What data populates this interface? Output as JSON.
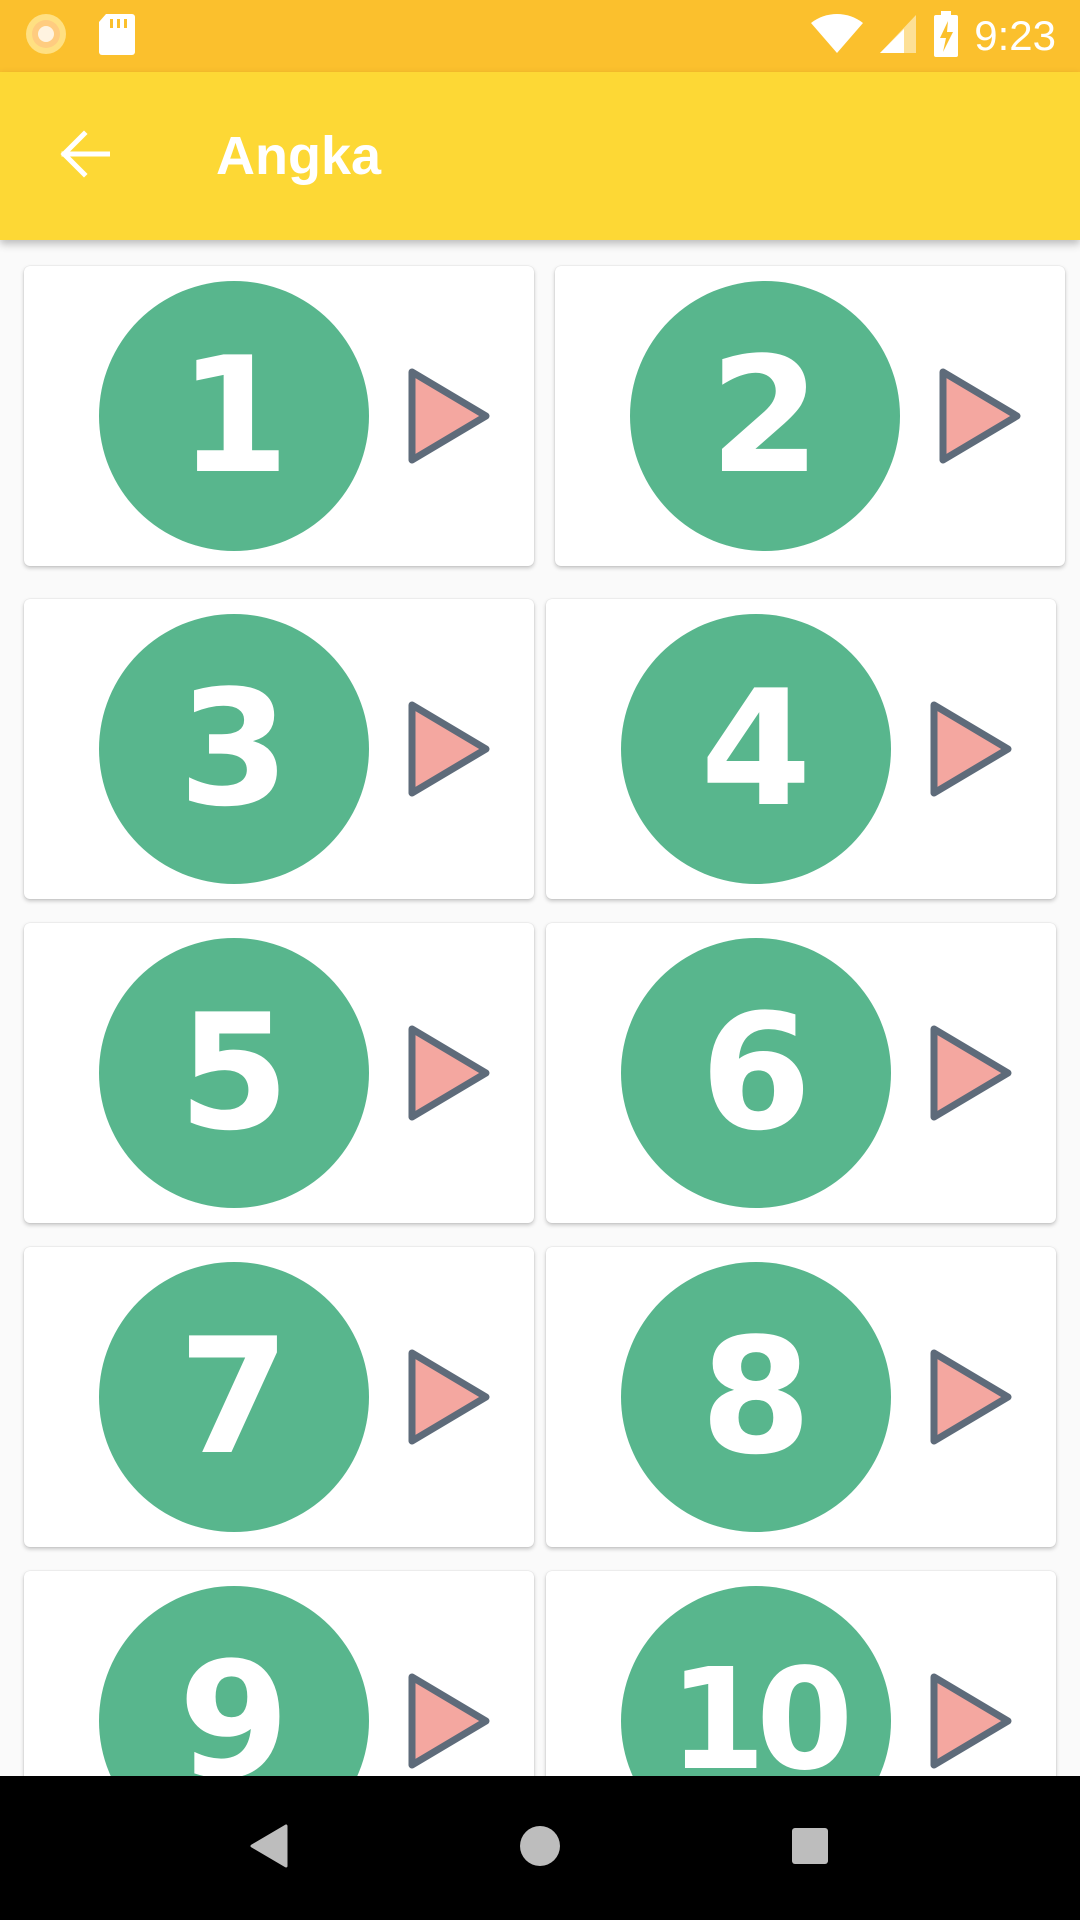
{
  "status_bar": {
    "time": "9:23"
  },
  "app_bar": {
    "title": "Angka"
  },
  "numbers": [
    "1",
    "2",
    "3",
    "4",
    "5",
    "6",
    "7",
    "8",
    "9",
    "10"
  ],
  "colors": {
    "status_bar": "#FBC02D",
    "app_bar": "#FDD835",
    "circle": "#58B68D",
    "play_fill": "#F4A7A0",
    "play_stroke": "#5E6B7A"
  }
}
